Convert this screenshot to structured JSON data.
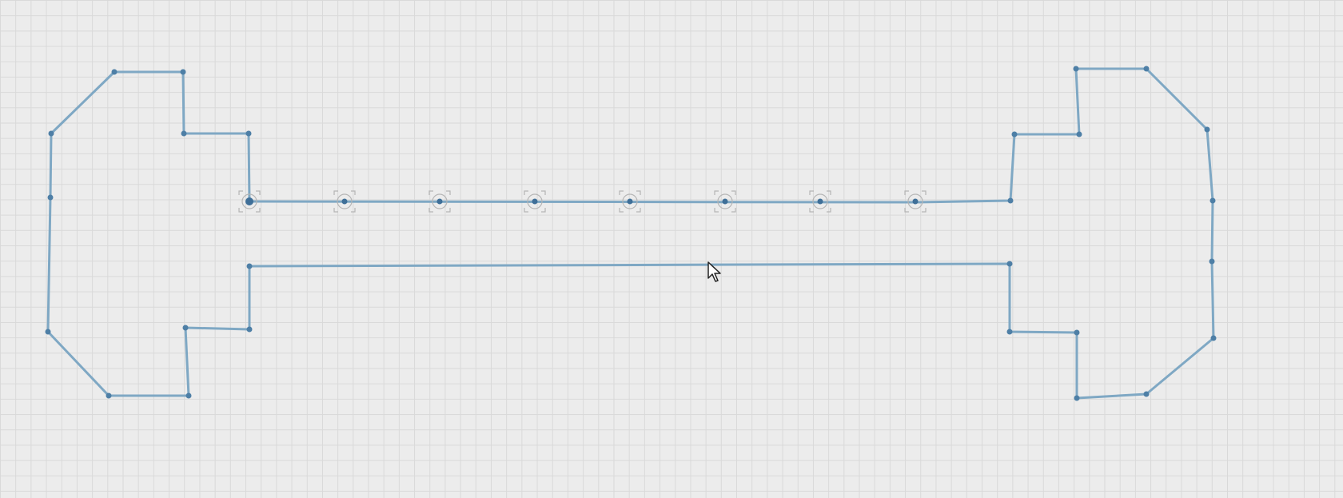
{
  "canvas": {
    "grid": true,
    "grid_color": "#d9d9d9",
    "background_color": "#ececec"
  },
  "drawing": {
    "stroke_color": "#7fa8c4",
    "node_color": "#4e7fa6",
    "selected_node_color": "#3f6f98",
    "handle_color": "#b5b5b5",
    "selected_node_count": 8
  },
  "cursor": {
    "icon": "arrow-pointer-icon"
  }
}
